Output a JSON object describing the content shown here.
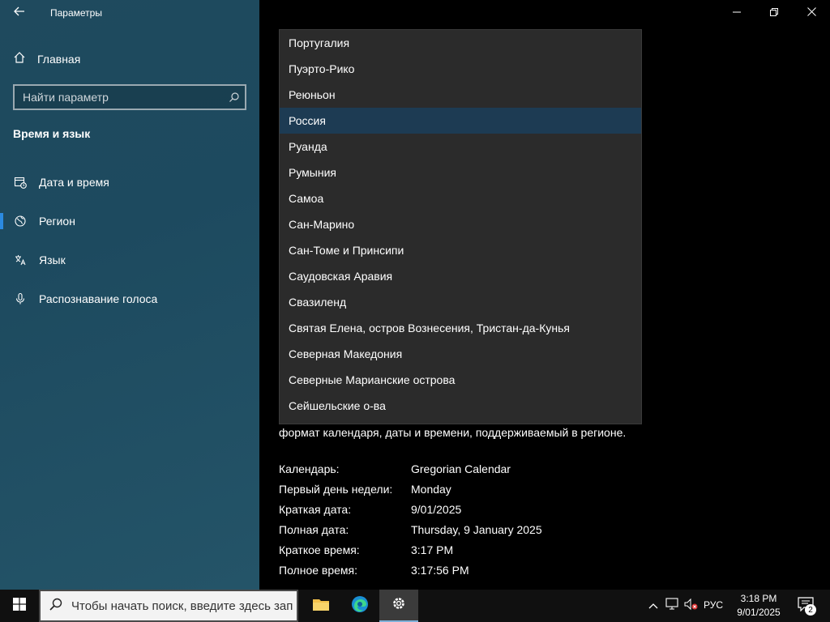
{
  "window": {
    "title": "Параметры"
  },
  "sidebar": {
    "home_label": "Главная",
    "search_placeholder": "Найти параметр",
    "section_title": "Время и язык",
    "items": [
      {
        "label": "Дата и время",
        "icon": "calendar-clock-icon"
      },
      {
        "label": "Регион",
        "icon": "globe-icon",
        "selected": true
      },
      {
        "label": "Язык",
        "icon": "language-icon"
      },
      {
        "label": "Распознавание голоса",
        "icon": "microphone-icon"
      }
    ]
  },
  "dropdown": {
    "options": [
      "Португалия",
      "Пуэрто-Рико",
      "Реюньон",
      "Россия",
      "Руанда",
      "Румыния",
      "Самоа",
      "Сан-Марино",
      "Сан-Томе и Принсипи",
      "Саудовская Аравия",
      "Свазиленд",
      "Святая Елена, остров Вознесения, Тристан-да-Кунья",
      "Северная Македония",
      "Северные Марианские острова",
      "Сейшельские о-ва"
    ],
    "selected": "Россия"
  },
  "regional_format": {
    "note": "формат календаря, даты и времени, поддерживаемый в регионе.",
    "rows": [
      {
        "key": "Календарь:",
        "value": "Gregorian Calendar"
      },
      {
        "key": "Первый день недели:",
        "value": "Monday"
      },
      {
        "key": "Краткая дата:",
        "value": "9/01/2025"
      },
      {
        "key": "Полная дата:",
        "value": "Thursday, 9 January 2025"
      },
      {
        "key": "Краткое время:",
        "value": "3:17 PM"
      },
      {
        "key": "Полное время:",
        "value": "3:17:56 PM"
      }
    ]
  },
  "taskbar": {
    "search_placeholder": "Чтобы начать поиск, введите здесь зап",
    "language": "РУС",
    "time": "3:18 PM",
    "date": "9/01/2025",
    "notification_count": "2"
  },
  "colors": {
    "sidebar_bg": "#1f4a5e",
    "dropdown_bg": "#2b2b2b",
    "selected_bg": "#1d3b53",
    "accent": "#2b8ae0"
  }
}
